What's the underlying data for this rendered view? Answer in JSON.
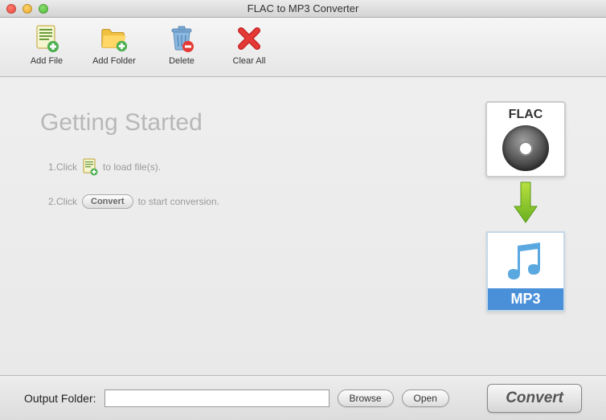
{
  "window": {
    "title": "FLAC to MP3 Converter"
  },
  "toolbar": {
    "add_file": "Add File",
    "add_folder": "Add Folder",
    "delete": "Delete",
    "clear_all": "Clear All"
  },
  "main": {
    "title": "Getting Started",
    "step1_prefix": "1.Click",
    "step1_suffix": "to load file(s).",
    "step2_prefix": "2.Click",
    "step2_button": "Convert",
    "step2_suffix": "to start conversion."
  },
  "illustration": {
    "source_format": "FLAC",
    "target_format": "MP3"
  },
  "bottom": {
    "output_label": "Output Folder:",
    "output_value": "",
    "browse": "Browse",
    "open": "Open",
    "convert": "Convert"
  }
}
